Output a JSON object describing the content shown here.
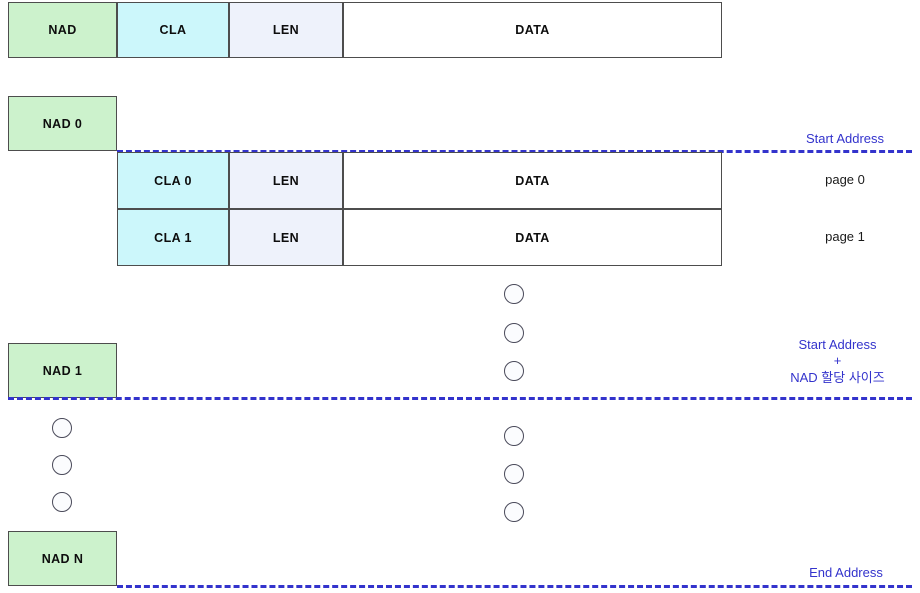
{
  "diagram": {
    "title": "NAD memory layout diagram",
    "colors": {
      "nad_fill": "#ccf2cc",
      "cla_fill": "#ccf7fb",
      "len_fill": "#eef2fb",
      "data_fill": "#ffffff",
      "border": "#4d4d4d",
      "accent_blue": "#3333cc",
      "label_dark": "#1a1a1a"
    },
    "frame_row": {
      "cells": [
        {
          "label": "NAD",
          "kind": "nad"
        },
        {
          "label": "CLA",
          "kind": "cla"
        },
        {
          "label": "LEN",
          "kind": "len"
        },
        {
          "label": "DATA",
          "kind": "data"
        }
      ]
    },
    "blocks": [
      {
        "label": "NAD 0"
      },
      {
        "label": "NAD 1"
      },
      {
        "label": "NAD N"
      }
    ],
    "pages": [
      {
        "cla": "CLA 0",
        "len": "LEN",
        "data": "DATA",
        "page_label": "page 0"
      },
      {
        "cla": "CLA 1",
        "len": "LEN",
        "data": "DATA",
        "page_label": "page 1"
      }
    ],
    "markers": [
      {
        "name": "start-address",
        "text": "Start Address"
      },
      {
        "name": "start-plus-size-l1",
        "text": "Start Address"
      },
      {
        "name": "start-plus-size-l2",
        "text": "+"
      },
      {
        "name": "start-plus-size-l3",
        "text": "NAD 할당 사이즈"
      },
      {
        "name": "end-address",
        "text": "End Address"
      }
    ]
  }
}
